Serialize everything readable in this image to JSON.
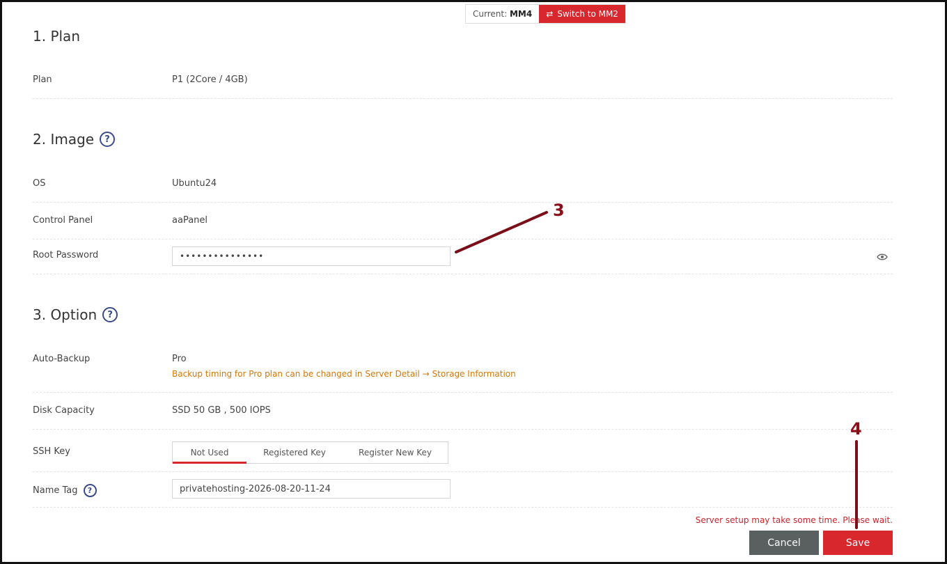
{
  "switcher": {
    "current_label": "Current:",
    "current_value": "MM4",
    "switch_label": "Switch to MM2"
  },
  "plan": {
    "title": "1. Plan",
    "label": "Plan",
    "value": "P1 (2Core / 4GB)"
  },
  "image": {
    "title": "2. Image",
    "os_label": "OS",
    "os_value": "Ubuntu24",
    "panel_label": "Control Panel",
    "panel_value": "aaPanel",
    "password_label": "Root Password",
    "password_value": "•••••••••••••••"
  },
  "option": {
    "title": "3. Option",
    "backup_label": "Auto-Backup",
    "backup_value": "Pro",
    "backup_note": "Backup timing for Pro plan can be changed in Server Detail → Storage Information",
    "disk_label": "Disk Capacity",
    "disk_value": "SSD 50 GB , 500 IOPS",
    "ssh_label": "SSH Key",
    "ssh_tabs": [
      "Not Used",
      "Registered Key",
      "Register New Key"
    ],
    "name_tag_label": "Name Tag",
    "name_tag_value": "privatehosting-2026-08-20-11-24"
  },
  "footer": {
    "warning": "Server setup may take some time. Please wait.",
    "cancel_label": "Cancel",
    "save_label": "Save"
  },
  "annotations": {
    "step3": "3",
    "step4": "4"
  },
  "colors": {
    "accent": "#d9272e",
    "annotation": "#8b0f1a",
    "note": "#d4780a",
    "cancel": "#5a5f5f"
  }
}
